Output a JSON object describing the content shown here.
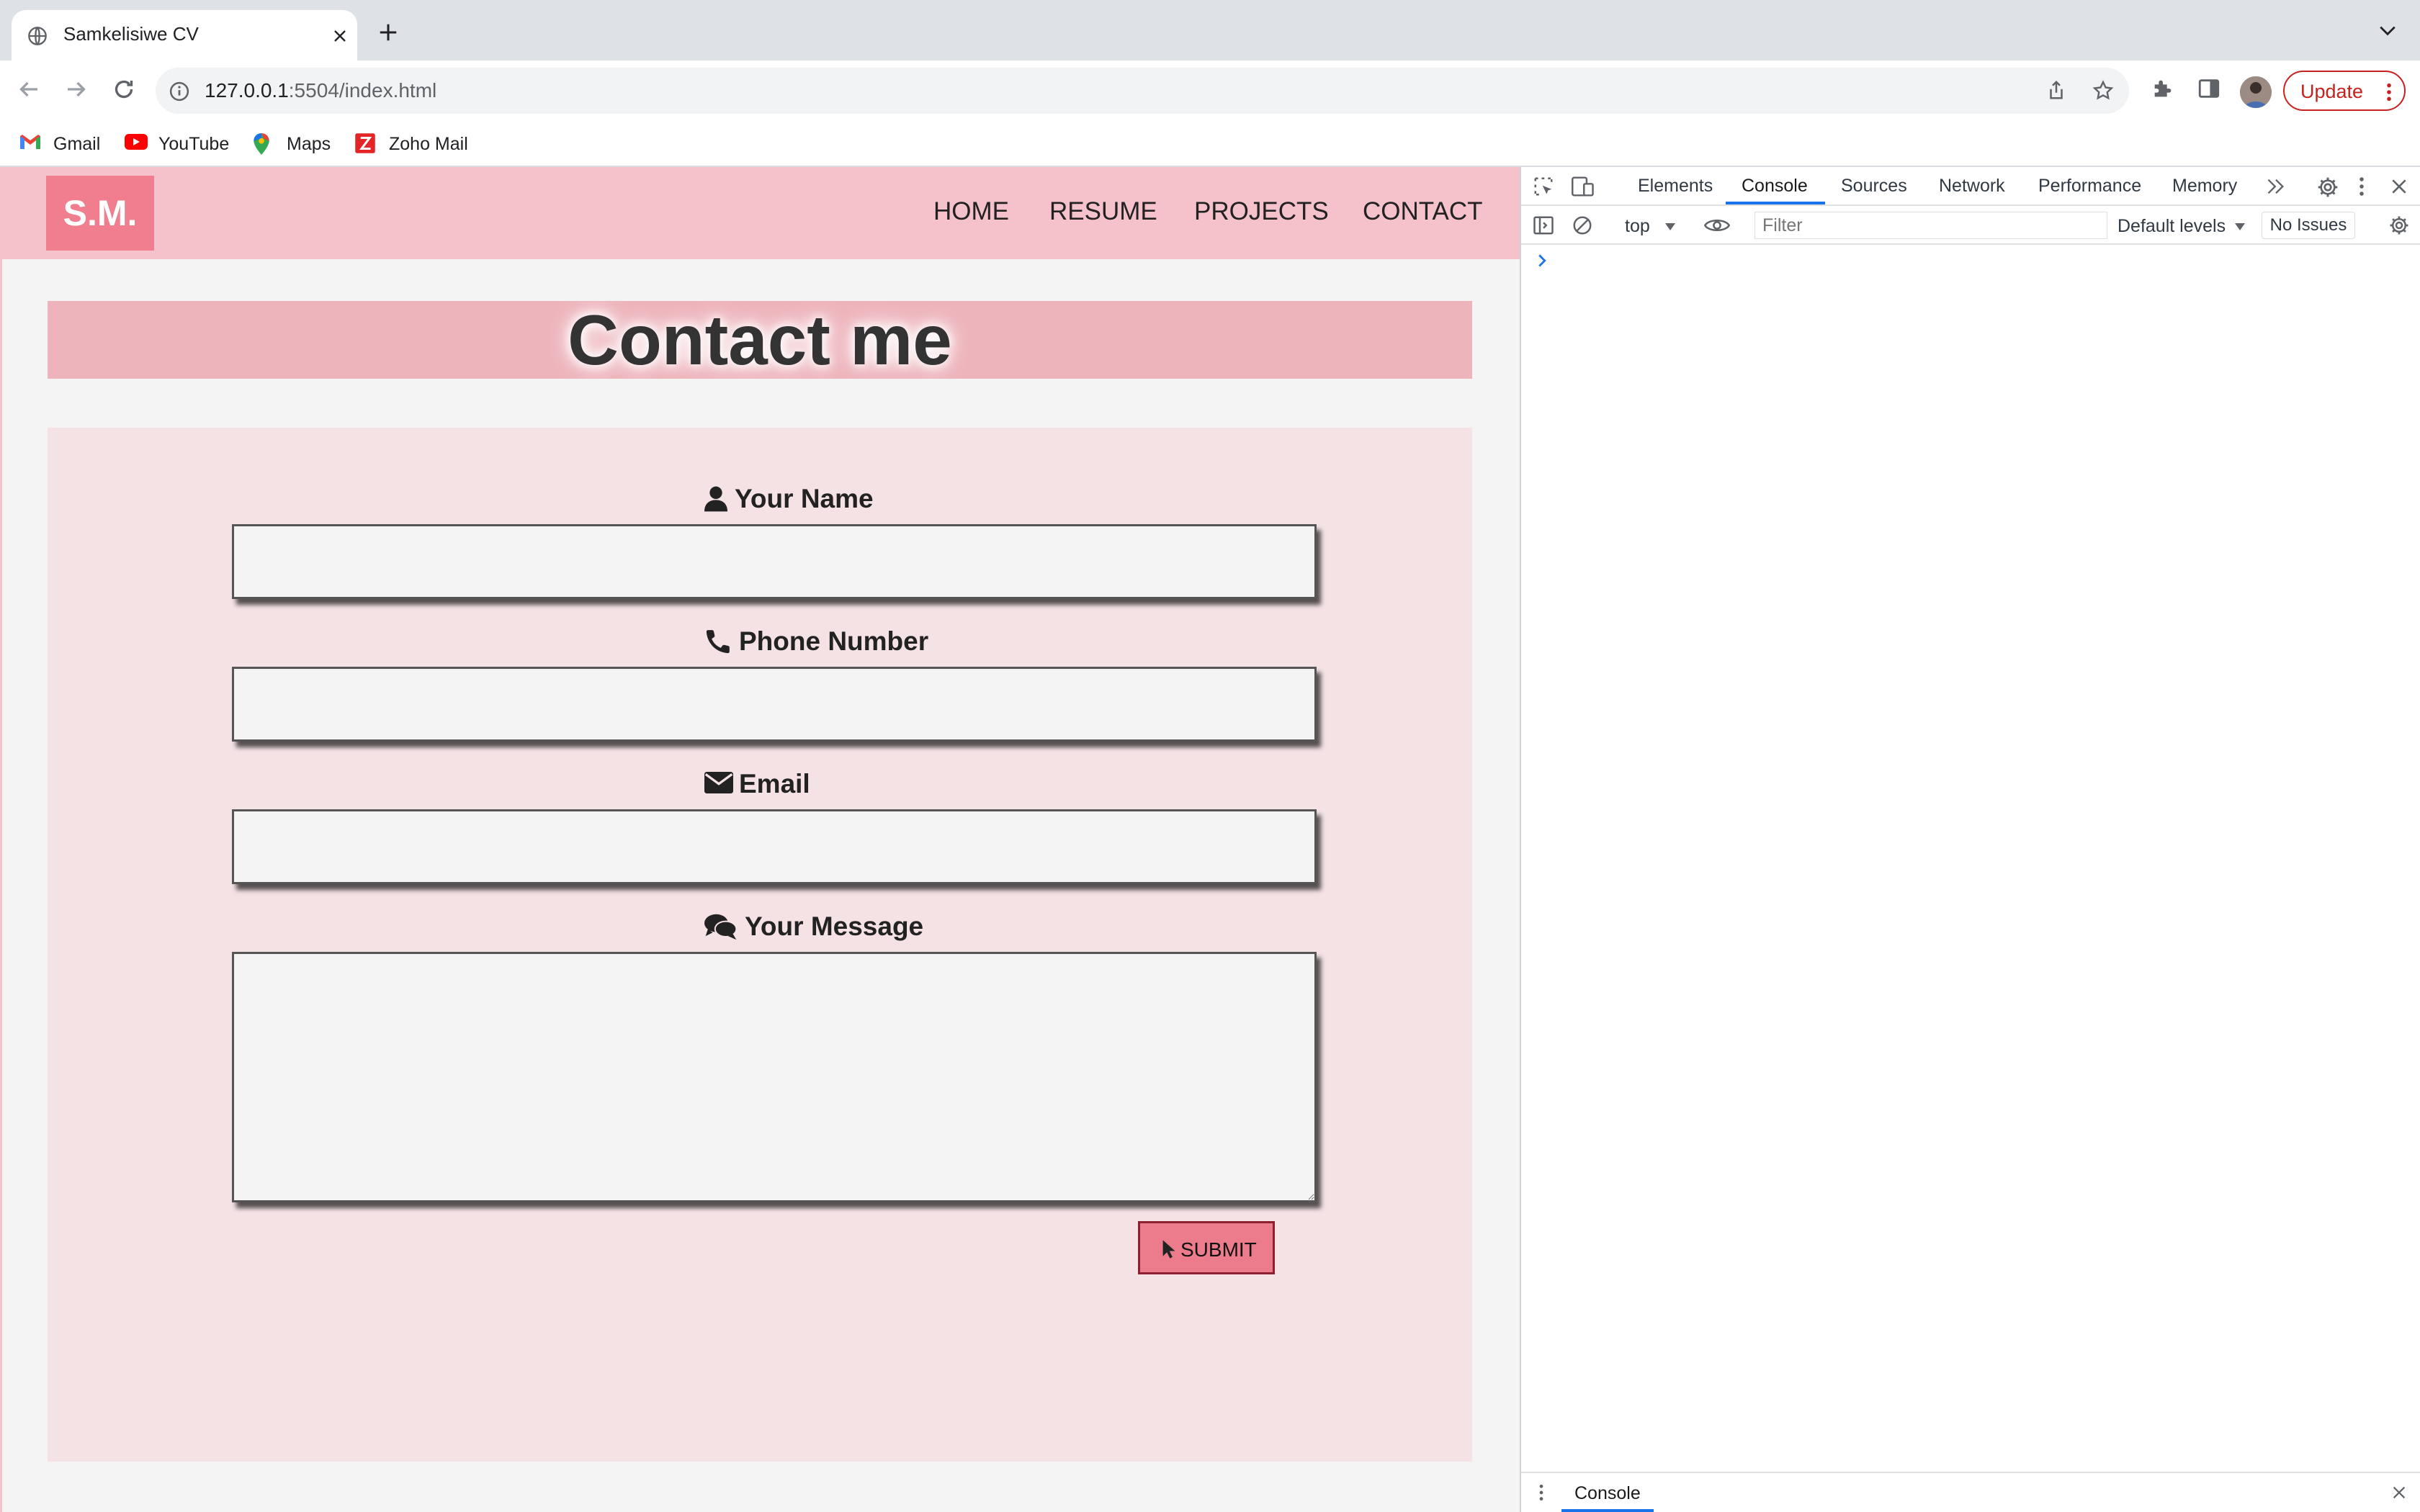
{
  "browser": {
    "tab_title": "Samkelisiwe CV",
    "url_host": "127.0.0.1",
    "url_rest": ":5504/index.html",
    "update_label": "Update",
    "bookmarks": [
      {
        "label": "Gmail",
        "icon": "gmail-icon"
      },
      {
        "label": "YouTube",
        "icon": "youtube-icon"
      },
      {
        "label": "Maps",
        "icon": "maps-icon"
      },
      {
        "label": "Zoho Mail",
        "icon": "zoho-icon"
      }
    ]
  },
  "site": {
    "logo": "S.M.",
    "nav": [
      "HOME",
      "RESUME",
      "PROJECTS",
      "CONTACT"
    ],
    "heading": "Contact me",
    "form": {
      "name_label": "Your Name",
      "phone_label": "Phone Number",
      "email_label": "Email",
      "message_label": "Your Message",
      "submit_label": "SUBMIT"
    }
  },
  "devtools": {
    "tabs": [
      "Elements",
      "Console",
      "Sources",
      "Network",
      "Performance",
      "Memory"
    ],
    "active_tab": "Console",
    "context": "top",
    "filter_placeholder": "Filter",
    "levels": "Default levels",
    "issues": "No Issues",
    "drawer_tab": "Console"
  },
  "colors": {
    "header_pink": "#f5c2cb",
    "logo_pink": "#f07e8e",
    "banner_pink": "#eeb4bb",
    "panel_pink": "#f4e2e5",
    "submit_pink": "#ec7c8c",
    "update_red": "#c5221f",
    "devtools_blue": "#1a73e8"
  }
}
